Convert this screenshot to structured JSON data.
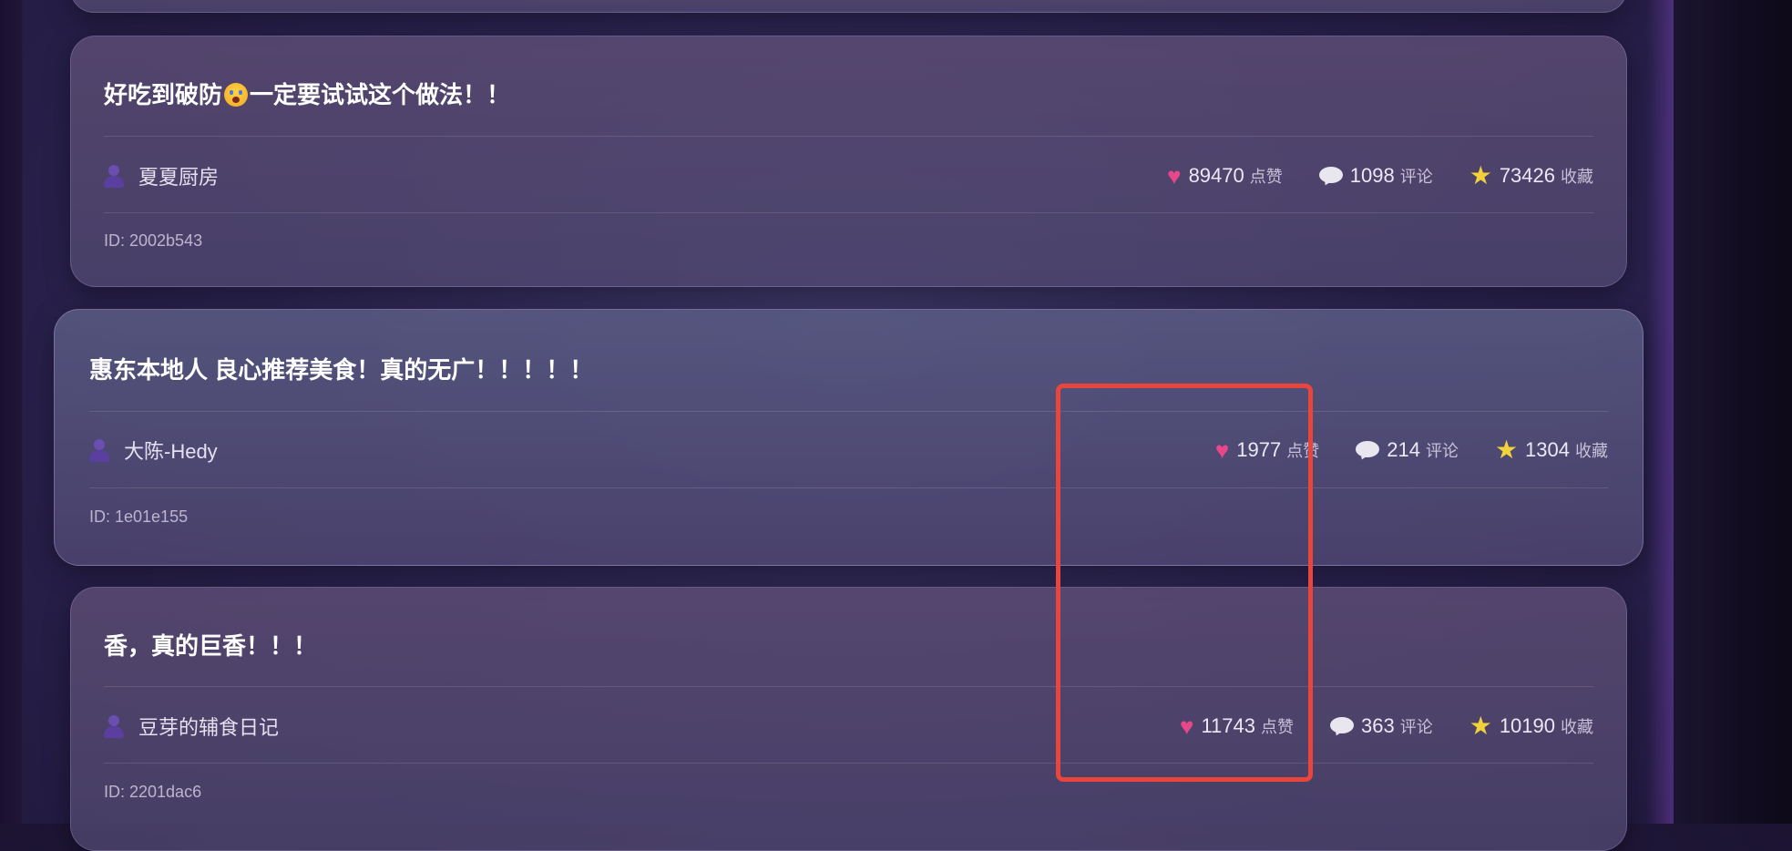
{
  "posts": [
    {
      "title_before": "好吃到破防",
      "title_after": "一定要试试这个做法！！",
      "author": "夏夏厨房",
      "likes": "89470",
      "likes_unit": "点赞",
      "comments": "1098",
      "comments_unit": "评论",
      "favorites": "73426",
      "favorites_unit": "收藏",
      "id_text": "ID: 2002b543"
    },
    {
      "title": "惠东本地人 良心推荐美食！真的无广！！！！！",
      "author": "大陈-Hedy",
      "likes": "1977",
      "likes_unit": "点赞",
      "comments": "214",
      "comments_unit": "评论",
      "favorites": "1304",
      "favorites_unit": "收藏",
      "id_text": "ID: 1e01e155"
    },
    {
      "title": "香，真的巨香！！！",
      "author": "豆芽的辅食日记",
      "likes": "11743",
      "likes_unit": "点赞",
      "comments": "363",
      "comments_unit": "评论",
      "favorites": "10190",
      "favorites_unit": "收藏",
      "id_text": "ID: 2201dac6"
    }
  ],
  "icons": {
    "author": "person-icon",
    "likes": "heart-icon",
    "comments": "comment-bubble-icon",
    "favorites": "star-icon",
    "title_emoji": "crying-face-emoji"
  },
  "colors": {
    "highlight_box": "#e8453c",
    "heart": "#e8478a",
    "star": "#f2d23a"
  }
}
